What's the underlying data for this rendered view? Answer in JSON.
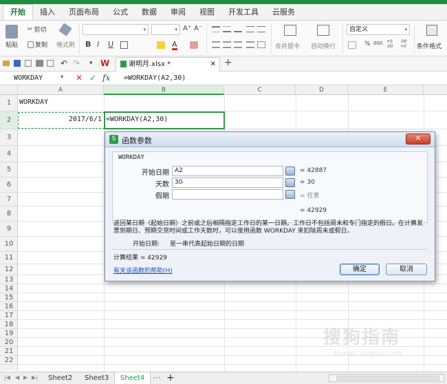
{
  "ribbon_tabs": [
    "开始",
    "插入",
    "页面布局",
    "公式",
    "数据",
    "审阅",
    "视图",
    "开发工具",
    "云服务"
  ],
  "clipboard": {
    "paste": "粘贴",
    "cut": "剪切",
    "copy": "复制",
    "format_painter": "格式刷"
  },
  "font": {
    "bold": "B",
    "italic": "I",
    "underline": "U",
    "grow": "A⁺",
    "shrink": "A⁻"
  },
  "alignment": {
    "merge_center": "合并居中",
    "wrap_text": "自动换行"
  },
  "number_format": {
    "value": "自定义",
    "percent": "%",
    "thousands": "000",
    "inc_decimal": "+0 .00",
    "dec_decimal": ".00 +0"
  },
  "styles": {
    "conditional_format": "条件格式"
  },
  "document_tab": {
    "title": "谢明月.xlsx *"
  },
  "name_box": "WORKDAY",
  "formula_bar": {
    "cancel": "✕",
    "confirm": "✓",
    "fx": "fx",
    "formula": "=WORKDAY(A2,30)"
  },
  "columns": [
    "A",
    "B",
    "C",
    "D",
    "E"
  ],
  "rows": [
    "1",
    "2",
    "3",
    "4",
    "5",
    "6",
    "7",
    "8",
    "9",
    "10",
    "11",
    "12",
    "13",
    "14",
    "15",
    "16",
    "17",
    "18",
    "19",
    "20",
    "21",
    "22"
  ],
  "cells": {
    "A1": "WORKDAY",
    "A2": "2017/6/1",
    "B2": "=WORKDAY(A2,30)"
  },
  "dialog": {
    "title": "函数参数",
    "function_name": "WORKDAY",
    "fields": [
      {
        "label": "开始日期",
        "value": "A2",
        "result": "= 42887"
      },
      {
        "label": "天数",
        "value": "30",
        "result": "= 30"
      },
      {
        "label": "假期",
        "value": "",
        "result": "= 任意"
      }
    ],
    "formula_result": "= 42929",
    "description": "返回某日期（起始日期）之前或之后相隔指定工作日的某一日期。工作日不包括周末和专门指定的假日。在计算发票到期日、预期交货时间或工作天数时，可以使用函数 WORKDAY 来扣除周末或假日。",
    "param_help_label": "开始日期:",
    "param_help_text": "是一串代表起始日期的日期",
    "calc_result": "计算结果 = 42929",
    "help_link": "有关该函数的帮助(H)",
    "ok": "确定",
    "cancel": "取消"
  },
  "sheets": [
    "Sheet2",
    "Sheet3",
    "Sheet4"
  ],
  "watermark": {
    "text": "搜狗指南",
    "url": "zhinan.sogou.com"
  },
  "colors": {
    "accent": "#1e8f3e",
    "selected_cell_border": "#2e9a48"
  }
}
